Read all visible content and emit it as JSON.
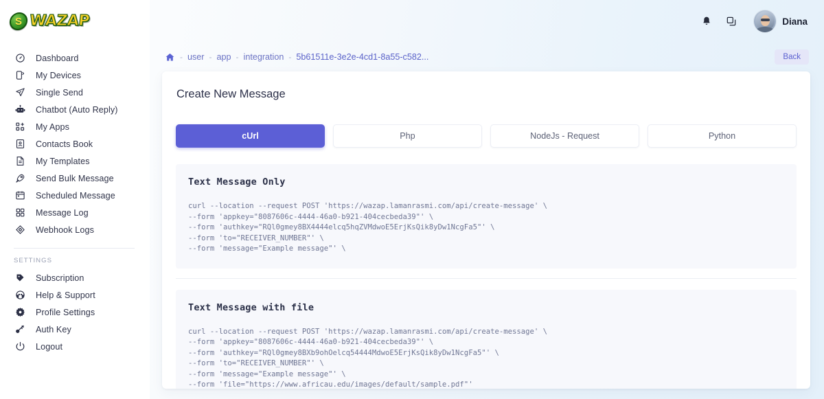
{
  "brand": {
    "badge_letter": "S",
    "name": "WAZAP",
    "logo_icon": "wazap-logo"
  },
  "sidebar": {
    "items": [
      {
        "label": "Dashboard",
        "icon": "gauge-icon"
      },
      {
        "label": "My Devices",
        "icon": "device-icon"
      },
      {
        "label": "Single Send",
        "icon": "paper-plane-icon"
      },
      {
        "label": "Chatbot (Auto Reply)",
        "icon": "robot-icon"
      },
      {
        "label": "My Apps",
        "icon": "apps-grid-plus-icon"
      },
      {
        "label": "Contacts Book",
        "icon": "contact-card-icon"
      },
      {
        "label": "My Templates",
        "icon": "document-icon"
      },
      {
        "label": "Send Bulk Message",
        "icon": "rocket-icon"
      },
      {
        "label": "Scheduled Message",
        "icon": "calendar-icon"
      },
      {
        "label": "Message Log",
        "icon": "log-blocks-icon"
      },
      {
        "label": "Webhook Logs",
        "icon": "webhook-diamond-icon"
      }
    ],
    "settings_label": "SETTINGS",
    "settings_items": [
      {
        "label": "Subscription",
        "icon": "subscription-tag-icon"
      },
      {
        "label": "Help & Support",
        "icon": "headset-icon"
      },
      {
        "label": "Profile Settings",
        "icon": "gear-icon"
      },
      {
        "label": "Auth Key",
        "icon": "key-icon"
      },
      {
        "label": "Logout",
        "icon": "power-icon"
      }
    ]
  },
  "topbar": {
    "menu_icon": "hamburger-icon",
    "notifications_icon": "bell-icon",
    "copy_icon": "copy-icon",
    "avatar_icon": "user-avatar",
    "user_name": "Diana"
  },
  "breadcrumb": {
    "home_icon": "home-icon",
    "separator": "-",
    "items": [
      {
        "label": "user"
      },
      {
        "label": "app"
      },
      {
        "label": "integration"
      },
      {
        "label": "5b61511e-3e2e-4cd1-8a55-c582..."
      }
    ],
    "back_label": "Back"
  },
  "main": {
    "title": "Create New Message",
    "tabs": [
      {
        "label": "cUrl",
        "active": true
      },
      {
        "label": "Php",
        "active": false
      },
      {
        "label": "NodeJs - Request",
        "active": false
      },
      {
        "label": "Python",
        "active": false
      }
    ],
    "blocks": [
      {
        "title": "Text Message Only",
        "code": "curl --location --request POST 'https://wazap.lamanrasmi.com/api/create-message' \\\n--form 'appkey=\"8087606c-4444-46a0-b921-404cecbeda39\"' \\\n--form 'authkey=\"RQl0gmey8BX4444elcq5hqZVMdwoE5ErjKsQik8yDw1NcgFa5\"' \\\n--form 'to=\"RECEIVER_NUMBER\"' \\\n--form 'message=\"Example message\"' \\"
      },
      {
        "title": "Text Message with file",
        "code": "curl --location --request POST 'https://wazap.lamanrasmi.com/api/create-message' \\\n--form 'appkey=\"8087606c-4444-46a0-b921-404cecbeda39\"' \\\n--form 'authkey=\"RQl0gmey8BXb9ohOelcq54444MdwoE5ErjKsQik8yDw1NcgFa5\"' \\\n--form 'to=\"RECEIVER_NUMBER\"' \\\n--form 'message=\"Example message\"' \\\n--form 'file=\"https://www.africau.edu/images/default/sample.pdf\"'"
      }
    ]
  },
  "colors": {
    "accent": "#5c5fd6",
    "accent_soft": "#e5e6f8",
    "code_bg": "#f7f8fc",
    "brand_yellow": "#f7cf26",
    "brand_green": "#3c9a28"
  }
}
